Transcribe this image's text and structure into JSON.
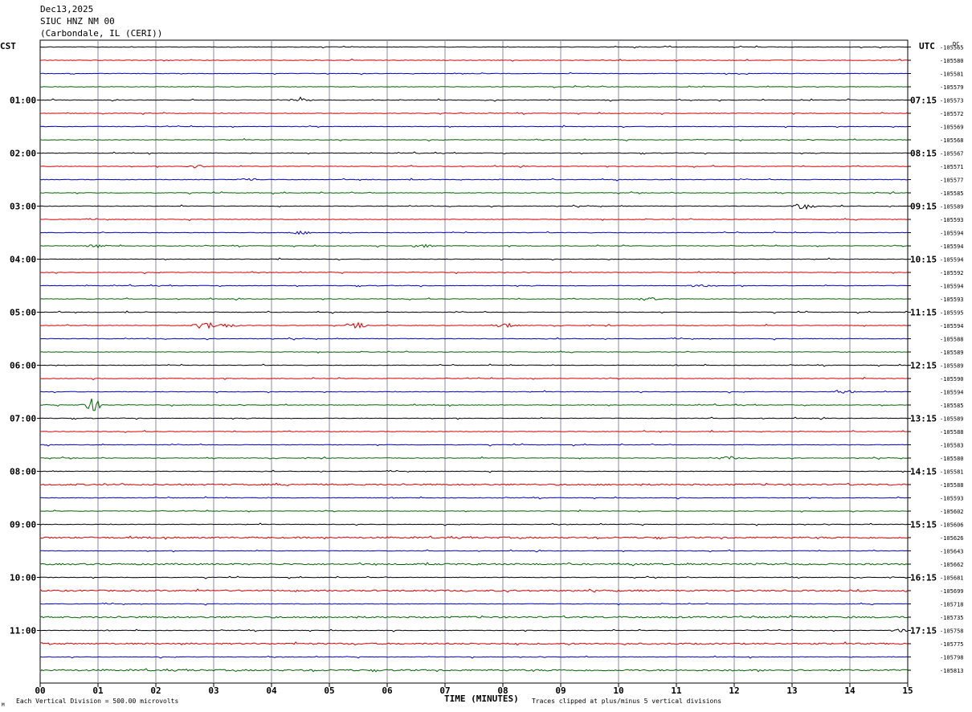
{
  "header": {
    "date": "Dec13,2025",
    "station": "SIUC HNZ NM 00",
    "location": "(Carbondale, IL (CERI))"
  },
  "axes": {
    "left_tz": "CST",
    "right_tz": "UTC",
    "dc_label": "DC",
    "xlabel": "TIME (MINUTES)",
    "footer_left": "Each Vertical Division =  500.00 microvolts",
    "footer_right": "Traces clipped at plus/minus 5 vertical divisions",
    "corner_mark": "M"
  },
  "colors": {
    "trace_cycle": [
      "#000000",
      "#d40000",
      "#0000c0",
      "#006400"
    ],
    "grid_vertical": "#8a8aa6",
    "frame": "#000000"
  },
  "chart_data": {
    "type": "line",
    "title": "SIUC HNZ NM 00",
    "xlabel": "TIME (MINUTES)",
    "x_ticks": [
      "00",
      "01",
      "02",
      "03",
      "04",
      "05",
      "06",
      "07",
      "08",
      "09",
      "10",
      "11",
      "12",
      "13",
      "14",
      "15"
    ],
    "xlim": [
      0,
      15
    ],
    "trace_count": 48,
    "left_hour_labels": [
      "01:00",
      "02:00",
      "03:00",
      "04:00",
      "05:00",
      "06:00",
      "07:00",
      "08:00",
      "09:00",
      "10:00",
      "11:00"
    ],
    "right_hour_labels": [
      "07:15",
      "08:15",
      "09:15",
      "10:15",
      "11:15",
      "12:15",
      "13:15",
      "14:15",
      "15:15",
      "16:15",
      "17:15"
    ],
    "dc_offsets": [
      "-105565",
      "-105580",
      "-105581",
      "-105579",
      "-105573",
      "-105572",
      "-105569",
      "-105568",
      "-105567",
      "-105571",
      "-105577",
      "-105585",
      "-105589",
      "-105593",
      "-105594",
      "-105594",
      "-105594",
      "-105592",
      "-105594",
      "-105593",
      "-105595",
      "-105594",
      "-105588",
      "-105589",
      "-105589",
      "-105590",
      "-105594",
      "-105585",
      "-105589",
      "-105588",
      "-105583",
      "-105580",
      "-105581",
      "-105588",
      "-105593",
      "-105602",
      "-105606",
      "-105626",
      "-105643",
      "-105662",
      "-105681",
      "-105699",
      "-105718",
      "-105735",
      "-105758",
      "-105775",
      "-105798",
      "-105813"
    ],
    "events": [
      {
        "trace": 4,
        "minute": 4.5,
        "amp": 2
      },
      {
        "trace": 9,
        "minute": 2.7,
        "amp": 2
      },
      {
        "trace": 10,
        "minute": 3.6,
        "amp": 2
      },
      {
        "trace": 12,
        "minute": 13.2,
        "amp": 4
      },
      {
        "trace": 14,
        "minute": 4.5,
        "amp": 2
      },
      {
        "trace": 15,
        "minute": 1.0,
        "amp": 2
      },
      {
        "trace": 15,
        "minute": 6.6,
        "amp": 2
      },
      {
        "trace": 18,
        "minute": 11.4,
        "amp": 2
      },
      {
        "trace": 19,
        "minute": 10.5,
        "amp": 2
      },
      {
        "trace": 21,
        "minute": 2.85,
        "amp": 5
      },
      {
        "trace": 21,
        "minute": 3.2,
        "amp": 3
      },
      {
        "trace": 21,
        "minute": 5.5,
        "amp": 3
      },
      {
        "trace": 21,
        "minute": 8.1,
        "amp": 3
      },
      {
        "trace": 26,
        "minute": 13.9,
        "amp": 2
      },
      {
        "trace": 27,
        "minute": 0.9,
        "amp": 8
      },
      {
        "trace": 31,
        "minute": 11.9,
        "amp": 2
      },
      {
        "trace": 44,
        "minute": 14.9,
        "amp": 2
      }
    ],
    "noisy_traces": [
      33,
      37,
      39,
      41,
      43,
      45,
      47
    ]
  }
}
